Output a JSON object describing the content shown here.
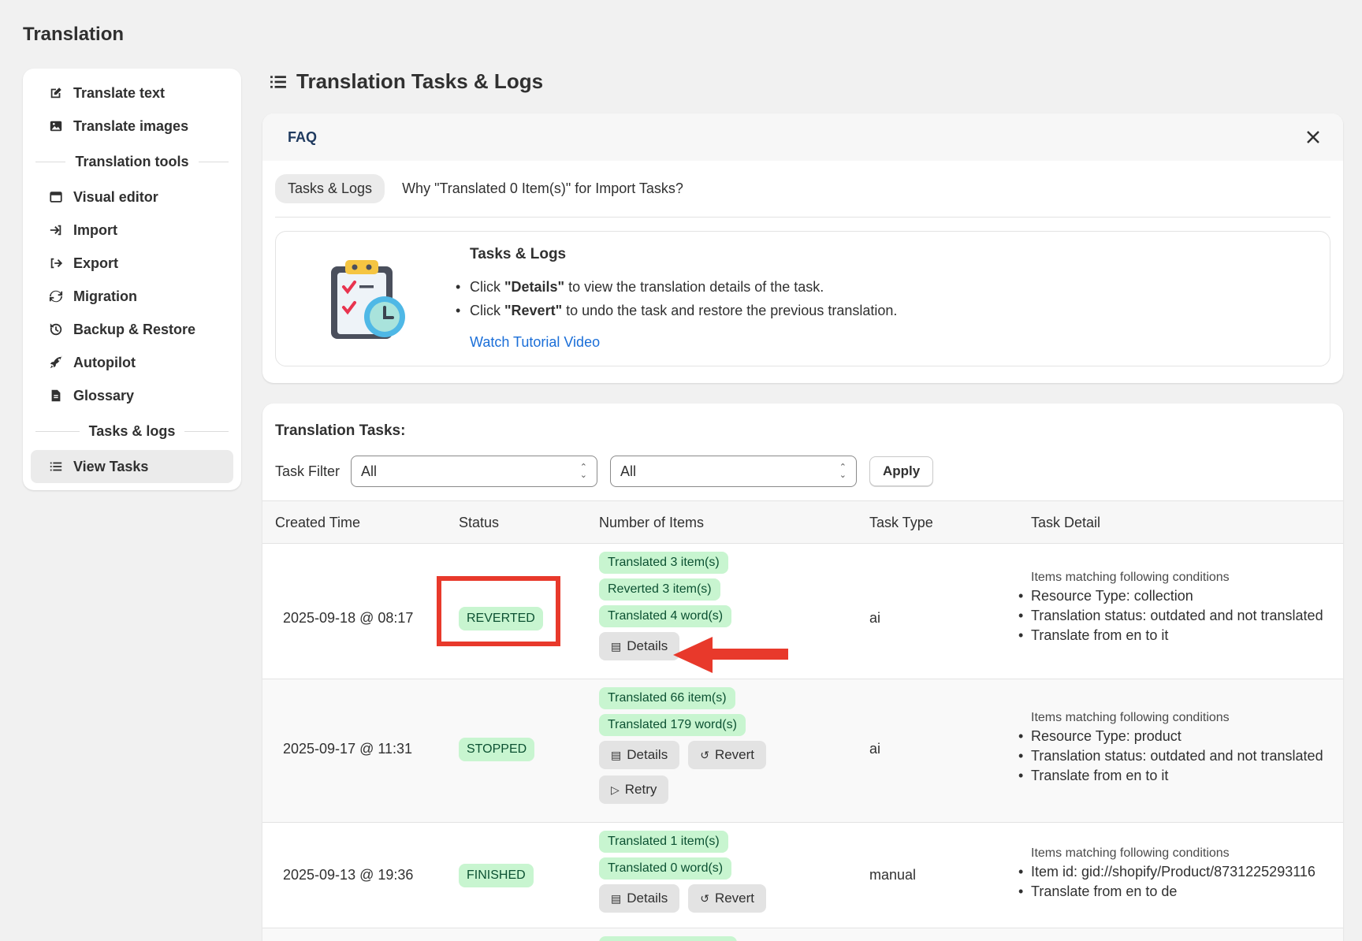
{
  "app": {
    "title": "Translation"
  },
  "sidebar": {
    "items": [
      {
        "label": "Translate text",
        "icon": "edit-icon"
      },
      {
        "label": "Translate images",
        "icon": "image-icon"
      }
    ],
    "section_tools": "Translation tools",
    "tools": [
      {
        "label": "Visual editor",
        "icon": "window-icon"
      },
      {
        "label": "Import",
        "icon": "import-icon"
      },
      {
        "label": "Export",
        "icon": "export-icon"
      },
      {
        "label": "Migration",
        "icon": "refresh-icon"
      },
      {
        "label": "Backup & Restore",
        "icon": "history-icon"
      },
      {
        "label": "Autopilot",
        "icon": "rocket-icon"
      },
      {
        "label": "Glossary",
        "icon": "document-icon"
      }
    ],
    "section_tasks": "Tasks & logs",
    "tasks": [
      {
        "label": "View Tasks",
        "icon": "list-icon",
        "active": true
      }
    ]
  },
  "page": {
    "title": "Translation Tasks & Logs"
  },
  "faq": {
    "title": "FAQ",
    "tabs": [
      "Tasks & Logs",
      "Why \"Translated 0 Item(s)\" for Import Tasks?"
    ],
    "panel_title": "Tasks & Logs",
    "bullet1_pre": "Click ",
    "bullet1_bold": "\"Details\"",
    "bullet1_post": " to view the translation details of the task.",
    "bullet2_pre": "Click ",
    "bullet2_bold": "\"Revert\"",
    "bullet2_post": " to undo the task and restore the previous translation.",
    "link": "Watch Tutorial Video"
  },
  "tasks": {
    "title": "Translation Tasks:",
    "filter_label": "Task Filter",
    "filter1": "All",
    "filter2": "All",
    "apply": "Apply",
    "columns": [
      "Created Time",
      "Status",
      "Number of Items",
      "Task Type",
      "Task Detail"
    ],
    "details_label": "Details",
    "revert_label": "Revert",
    "retry_label": "Retry",
    "detail_caption": "Items matching following conditions",
    "rows": [
      {
        "created": "2025-09-18 @ 08:17",
        "status": "REVERTED",
        "badges": [
          "Translated 3 item(s)",
          "Reverted 3 item(s)",
          "Translated 4 word(s)"
        ],
        "type": "ai",
        "details": [
          "Resource Type: collection",
          "Translation status: outdated and not translated",
          "Translate from en to it"
        ]
      },
      {
        "created": "2025-09-17 @ 11:31",
        "status": "STOPPED",
        "badges": [
          "Translated 66 item(s)",
          "Translated 179 word(s)"
        ],
        "type": "ai",
        "details": [
          "Resource Type: product",
          "Translation status: outdated and not translated",
          "Translate from en to it"
        ]
      },
      {
        "created": "2025-09-13 @ 19:36",
        "status": "FINISHED",
        "badges": [
          "Translated 1 item(s)",
          "Translated 0 word(s)"
        ],
        "type": "manual",
        "details": [
          "Item id: gid://shopify/Product/8731225293116",
          "Translate from en to de"
        ]
      }
    ]
  },
  "colors": {
    "accent": "#e8392b",
    "badge_bg": "#c8f5d0",
    "badge_text": "#0c5132",
    "link": "#1a6ed8"
  }
}
